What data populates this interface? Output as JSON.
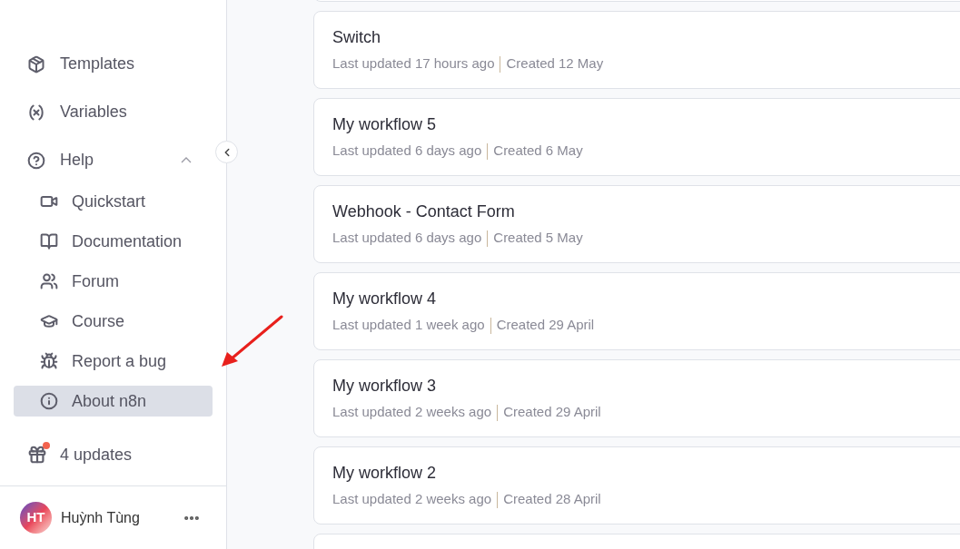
{
  "sidebar": {
    "items": [
      {
        "kind": "templates",
        "label": "Templates"
      },
      {
        "kind": "variables",
        "label": "Variables"
      },
      {
        "kind": "help",
        "label": "Help",
        "expanded": true,
        "children": [
          {
            "kind": "video",
            "label": "Quickstart",
            "selected": false
          },
          {
            "kind": "book",
            "label": "Documentation",
            "selected": false
          },
          {
            "kind": "users",
            "label": "Forum",
            "selected": false
          },
          {
            "kind": "course",
            "label": "Course",
            "selected": false
          },
          {
            "kind": "bug",
            "label": "Report a bug",
            "selected": false
          },
          {
            "kind": "info",
            "label": "About n8n",
            "selected": true
          }
        ]
      }
    ],
    "updates": {
      "label": "4 updates",
      "notification": true
    },
    "user": {
      "initials": "HT",
      "name": "Huỳnh Tùng"
    }
  },
  "workflows": [
    {
      "name": "Switch",
      "updated": "Last updated 17 hours ago",
      "created": "Created 12 May"
    },
    {
      "name": "My workflow 5",
      "updated": "Last updated 6 days ago",
      "created": "Created 6 May"
    },
    {
      "name": "Webhook - Contact Form",
      "updated": "Last updated 6 days ago",
      "created": "Created 5 May"
    },
    {
      "name": "My workflow 4",
      "updated": "Last updated 1 week ago",
      "created": "Created 29 April"
    },
    {
      "name": "My workflow 3",
      "updated": "Last updated 2 weeks ago",
      "created": "Created 29 April"
    },
    {
      "name": "My workflow 2",
      "updated": "Last updated 2 weeks ago",
      "created": "Created 28 April"
    }
  ]
}
